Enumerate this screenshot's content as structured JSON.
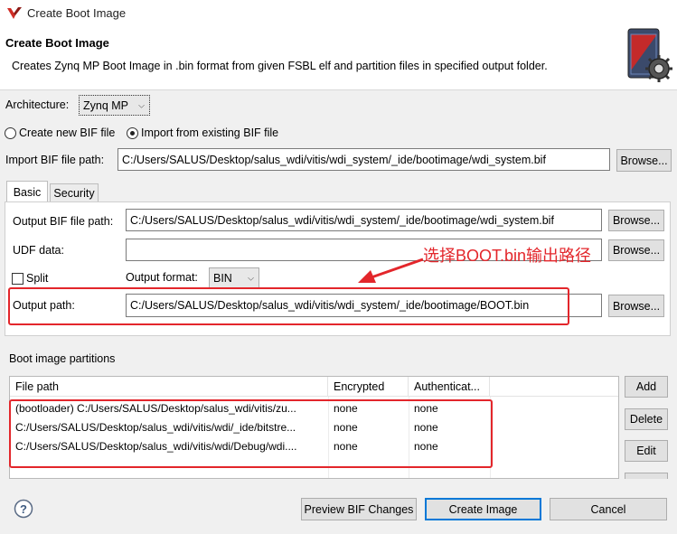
{
  "window": {
    "title": "Create Boot Image"
  },
  "header": {
    "title": "Create Boot Image",
    "description": "Creates Zynq MP Boot Image in .bin format from given FSBL elf and partition files in specified output folder."
  },
  "architecture": {
    "label": "Architecture:",
    "value": "Zynq MP"
  },
  "bif_mode": {
    "create_label": "Create new BIF file",
    "import_label": "Import from existing BIF file",
    "selected": "import"
  },
  "import_bif": {
    "label": "Import BIF file path:",
    "value": "C:/Users/SALUS/Desktop/salus_wdi/vitis/wdi_system/_ide/bootimage/wdi_system.bif",
    "browse": "Browse..."
  },
  "tabs": [
    {
      "label": "Basic",
      "active": true
    },
    {
      "label": "Security",
      "active": false
    }
  ],
  "basic": {
    "output_bif": {
      "label": "Output BIF file path:",
      "value": "C:/Users/SALUS/Desktop/salus_wdi/vitis/wdi_system/_ide/bootimage/wdi_system.bif",
      "browse": "Browse..."
    },
    "udf": {
      "label": "UDF data:",
      "value": "",
      "browse": "Browse..."
    },
    "split": {
      "label": "Split",
      "checked": false
    },
    "output_format": {
      "label": "Output format:",
      "value": "BIN"
    },
    "output_path": {
      "label": "Output path:",
      "value": "C:/Users/SALUS/Desktop/salus_wdi/vitis/wdi_system/_ide/bootimage/BOOT.bin",
      "browse": "Browse..."
    }
  },
  "annotation": {
    "text": "选择BOOT.bin输出路径",
    "color": "#e3262b"
  },
  "partitions": {
    "label": "Boot image partitions",
    "columns": [
      "File path",
      "Encrypted",
      "Authenticat..."
    ],
    "rows": [
      {
        "path": "(bootloader) C:/Users/SALUS/Desktop/salus_wdi/vitis/zu...",
        "encrypted": "none",
        "authenticated": "none"
      },
      {
        "path": "C:/Users/SALUS/Desktop/salus_wdi/vitis/wdi/_ide/bitstre...",
        "encrypted": "none",
        "authenticated": "none"
      },
      {
        "path": "C:/Users/SALUS/Desktop/salus_wdi/vitis/wdi/Debug/wdi....",
        "encrypted": "none",
        "authenticated": "none"
      }
    ],
    "buttons": {
      "add": "Add",
      "delete": "Delete",
      "edit": "Edit"
    }
  },
  "footer": {
    "help_icon": "help-icon",
    "preview": "Preview BIF Changes",
    "create": "Create Image",
    "cancel": "Cancel"
  },
  "colors": {
    "accent": "#0078d7",
    "highlight": "#e3262b",
    "background": "#f0f0f0"
  }
}
